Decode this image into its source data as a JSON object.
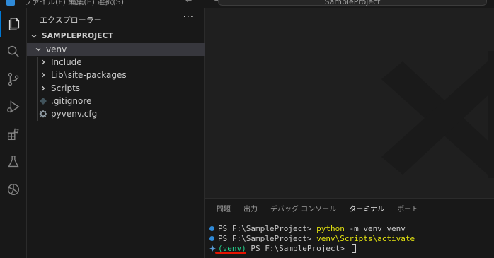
{
  "titlebar": {
    "menu_text": "ファイル(F)  編集(E)  選択(S)",
    "nav_text": "← →",
    "search_text": "SampleProject"
  },
  "activity_bar": {
    "items": [
      "explorer",
      "search",
      "source-control",
      "run-debug",
      "extensions",
      "testing",
      "chatgpt"
    ]
  },
  "sidebar": {
    "title": "エクスプローラー",
    "more": "···",
    "root": "SAMPLEPROJECT",
    "tree": [
      {
        "label": "venv",
        "type": "folder-open"
      },
      {
        "label": "Include",
        "type": "folder"
      },
      {
        "label": "Lib",
        "sep": "\\",
        "label2": "site-packages",
        "type": "folder"
      },
      {
        "label": "Scripts",
        "type": "folder"
      },
      {
        "label": ".gitignore",
        "type": "file"
      },
      {
        "label": "pyvenv.cfg",
        "type": "file"
      }
    ]
  },
  "panel": {
    "tabs": [
      "問題",
      "出力",
      "デバッグ コンソール",
      "ターミナル",
      "ポート"
    ],
    "active_tab": "ターミナル",
    "terminal": {
      "line1": {
        "prompt": "PS F:\\SampleProject> ",
        "cmd": "python",
        "args": " -m venv venv"
      },
      "line2": {
        "prompt": "PS F:\\SampleProject> ",
        "cmd": "venv\\Scripts\\activate"
      },
      "line3": {
        "venv": "(venv)",
        "prompt": " PS F:\\SampleProject> "
      }
    }
  },
  "colors": {
    "accent": "#0078d4",
    "terminal_cmd": "#e5e510",
    "terminal_venv": "#23d18b",
    "annotation": "#e51400"
  }
}
